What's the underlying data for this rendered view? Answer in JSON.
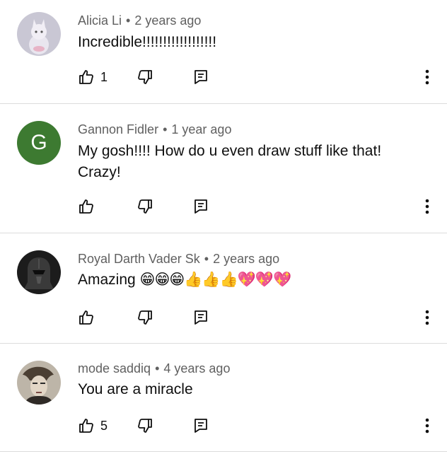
{
  "comments": [
    {
      "author": "Alicia Li",
      "time": "2 years ago",
      "text": "Incredible!!!!!!!!!!!!!!!!!!",
      "likes": "1",
      "avatar": {
        "type": "image",
        "description_icon": "cat-figurine-avatar"
      }
    },
    {
      "author": "Gannon Fidler",
      "time": "1 year ago",
      "text": "My gosh!!!! How do u even draw stuff like that! Crazy!",
      "likes": "",
      "avatar": {
        "type": "letter",
        "letter": "G",
        "color": "#3d7a31"
      }
    },
    {
      "author": "Royal Darth Vader Sk",
      "time": "2 years ago",
      "text": "Amazing",
      "emojis": "😁😁😁👍👍👍💖💖💖",
      "likes": "",
      "avatar": {
        "type": "image",
        "description_icon": "darth-vader-avatar"
      }
    },
    {
      "author": "mode saddiq",
      "time": "4 years ago",
      "text": "You are a miracle",
      "likes": "5",
      "avatar": {
        "type": "image",
        "description_icon": "portrait-avatar"
      }
    }
  ],
  "separator": "•"
}
